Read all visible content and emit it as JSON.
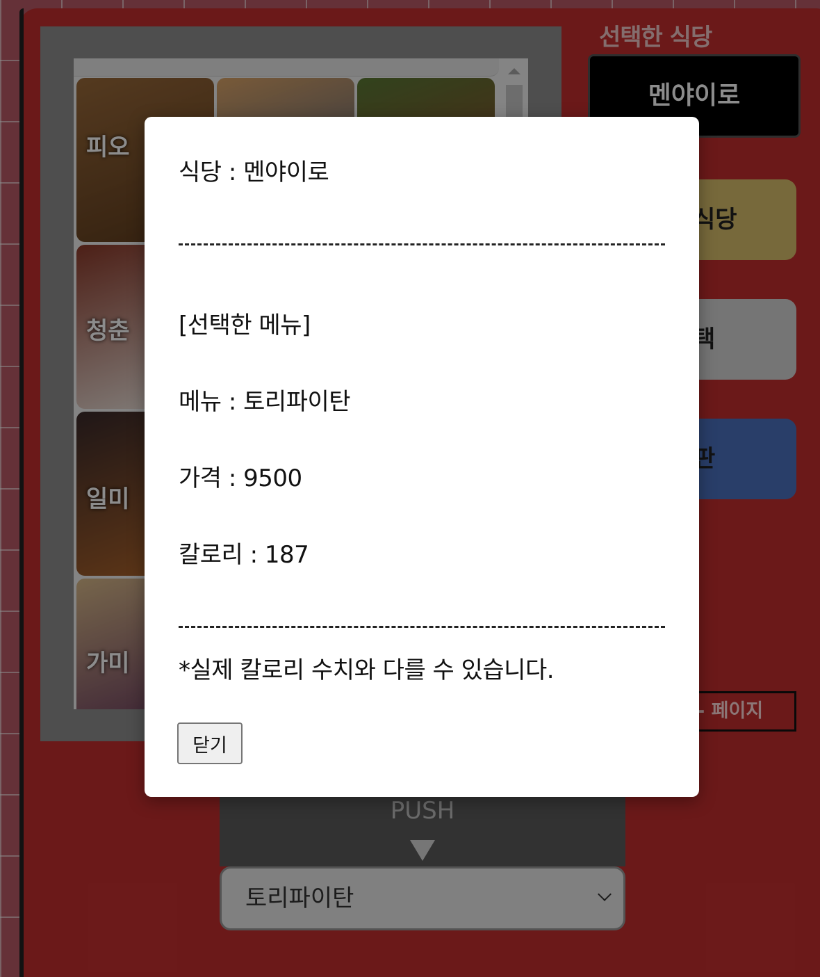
{
  "panel": {
    "title": "선택한 식당",
    "selected_restaurant": "멘야이로",
    "category_buttons": [
      {
        "label": "식당",
        "color": "#d9c06c"
      },
      {
        "label": "택",
        "color": "#d6d6d6"
      },
      {
        "label": "판",
        "color": "#4b72c0"
      }
    ],
    "page_button": "- 페이지"
  },
  "grid": {
    "tiles": [
      {
        "label": "피오",
        "colors": [
          "#9a6a3a",
          "#5d3b1d"
        ]
      },
      {
        "label": "",
        "colors": [
          "#2c4d7c",
          "#dba468"
        ]
      },
      {
        "label": "",
        "colors": [
          "#5b7a34",
          "#9b3a2a"
        ]
      },
      {
        "label": "청춘",
        "colors": [
          "#8c3a2a",
          "#f2eee8"
        ]
      },
      {
        "label": "일미",
        "colors": [
          "#3a2a2a",
          "#b4672a"
        ]
      },
      {
        "label": "가미",
        "colors": [
          "#d8b98a",
          "#5a2a5a"
        ]
      }
    ]
  },
  "push": {
    "label": "PUSH"
  },
  "dropdown": {
    "value": "토리파이탄"
  },
  "modal": {
    "restaurant_line": "식당 : 멘야이로",
    "section_title": "[선택한 메뉴]",
    "menu_line": "메뉴 : 토리파이탄",
    "price_line": "가격 : 9500",
    "calorie_line": "칼로리 : 187",
    "notice": "*실제 칼로리 수치와 다를 수 있습니다.",
    "close_label": "닫기"
  }
}
